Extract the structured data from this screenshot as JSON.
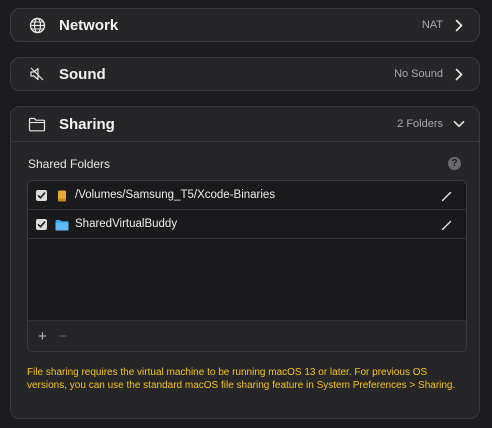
{
  "network": {
    "title": "Network",
    "value": "NAT",
    "icon": "globe-icon"
  },
  "sound": {
    "title": "Sound",
    "value": "No Sound",
    "icon": "speaker-muted-icon"
  },
  "sharing": {
    "title": "Sharing",
    "value": "2 Folders",
    "icon": "folder-icon",
    "shared_folders_label": "Shared Folders",
    "help_label": "?",
    "folders": [
      {
        "path": "/Volumes/Samsung_T5/Xcode-Binaries",
        "checked": true,
        "icon": "external-drive-icon"
      },
      {
        "path": "SharedVirtualBuddy",
        "checked": true,
        "icon": "folder-blue-icon"
      }
    ],
    "add_label": "+",
    "remove_label": "−",
    "note": "File sharing requires the virtual machine to be running macOS 13 or later. For previous OS versions, you can use the standard macOS file sharing feature in System Preferences > Sharing."
  },
  "colors": {
    "accent_warning": "#f5c518",
    "background": "#1c1c1e",
    "card": "#262628"
  }
}
